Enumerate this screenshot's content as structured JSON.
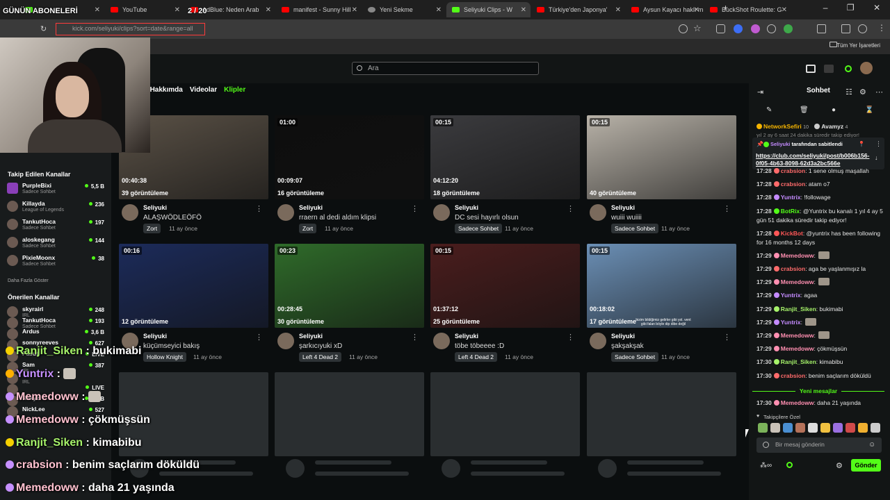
{
  "tabs": [
    {
      "label": "",
      "icon": "kick-icon"
    },
    {
      "label": "YouTube",
      "icon": "youtube-icon"
    },
    {
      "label": "AdBlue: Neden Arab",
      "icon": "youtube-icon"
    },
    {
      "label": "manifest - Sunny Hill",
      "icon": "youtube-icon"
    },
    {
      "label": "Yeni Sekme",
      "icon": "chrome-icon"
    },
    {
      "label": "Seliyuki Clips - W",
      "icon": "kick-icon",
      "active": true
    },
    {
      "label": "Türkiye'den Japonya'",
      "icon": "youtube-icon"
    },
    {
      "label": "Aysun Kayacı haklı m",
      "icon": "youtube-icon"
    },
    {
      "label": "BuckShot Roulette: G",
      "icon": "youtube-icon"
    }
  ],
  "address": {
    "url": "kick.com/seliyuki/clips?sort=date&range=all"
  },
  "bookmarks": {
    "all_label": "Tüm Yer İşaretleri"
  },
  "overlay": {
    "subs_label": "GÜNÜN ABONELERİ",
    "subs_count": "2 / 20"
  },
  "search": {
    "placeholder": "Ara"
  },
  "nav": {
    "partial": "a",
    "about": "Hakkımda",
    "videos": "Videolar",
    "clips": "Klipler"
  },
  "sidebar": {
    "followed_header": "Takip Edilen Kanallar",
    "followed": [
      {
        "name": "PurpleBixi",
        "sub": "Sadece Sohbet",
        "count": "5,5 B"
      },
      {
        "name": "Killayda",
        "sub": "League of Legends",
        "count": "236"
      },
      {
        "name": "TankutHoca",
        "sub": "Sadece Sohbet",
        "count": "197"
      },
      {
        "name": "aloskegang",
        "sub": "Sadece Sohbet",
        "count": "144"
      },
      {
        "name": "PixieMoonx",
        "sub": "Sadece Sohbet",
        "count": "38"
      }
    ],
    "show_more": "Daha Fazla Göster",
    "recommended_header": "Önerilen Kanallar",
    "recommended": [
      {
        "name": "skyrairl",
        "sub": "IRL",
        "count": "248"
      },
      {
        "name": "TankutHoca",
        "sub": "Sadece Sohbet",
        "count": "193"
      },
      {
        "name": "Ardus",
        "sub": "",
        "count": "3,6 B"
      },
      {
        "name": "sonnyreeves",
        "sub": "",
        "count": "627"
      },
      {
        "name": "Pasut",
        "sub": "",
        "count": "LIVE"
      },
      {
        "name": "Sam",
        "sub": "IRL",
        "count": "387"
      },
      {
        "name": "",
        "sub": "IRL",
        "count": ""
      },
      {
        "name": "",
        "sub": "",
        "count": "LIVE"
      },
      {
        "name": "Rakyz",
        "sub": "",
        "count": "3,3 B"
      },
      {
        "name": "NickLee",
        "sub": "",
        "count": "527"
      }
    ]
  },
  "clips": [
    {
      "duration": "",
      "timecode": "00:40:38",
      "views": "39 görüntüleme",
      "user": "Seliyuki",
      "title": "ALAŞWÖDLEÖFÖ",
      "tag": "Zort",
      "age": "11 ay önce",
      "bg": "#5a5146"
    },
    {
      "duration": "01:00",
      "timecode": "00:09:07",
      "views": "16 görüntüleme",
      "user": "Seliyuki",
      "title": "rraern al dedi aldım klipsi",
      "tag": "Zort",
      "age": "11 ay önce",
      "bg": "#0e0e0e"
    },
    {
      "duration": "00:15",
      "timecode": "04:12:20",
      "views": "18 görüntüleme",
      "user": "Seliyuki",
      "title": "DC sesi hayırlı olsun",
      "tag": "Sadece Sohbet",
      "age": "11 ay önce",
      "bg": "#3b3b3e"
    },
    {
      "duration": "00:15",
      "timecode": "",
      "views": "40 görüntüleme",
      "user": "Seliyuki",
      "title": "wuiii wuiiii",
      "tag": "Sadece Sohbet",
      "age": "11 ay önce",
      "bg": "#b8b2a8"
    },
    {
      "duration": "00:16",
      "timecode": "",
      "views": "12 görüntüleme",
      "user": "Seliyuki",
      "title": "küçümseyici bakış",
      "tag": "Hollow Knight",
      "age": "11 ay önce",
      "bg": "#1c2b5a"
    },
    {
      "duration": "00:23",
      "timecode": "00:28:45",
      "views": "30 görüntüleme",
      "user": "Seliyuki",
      "title": "şarkıcıyuki xD",
      "tag": "Left 4 Dead 2",
      "age": "11 ay önce",
      "bg": "#2f6b2a"
    },
    {
      "duration": "00:15",
      "timecode": "01:37:12",
      "views": "25 görüntüleme",
      "user": "Seliyuki",
      "title": "töbe töbeeee :D",
      "tag": "Left 4 Dead 2",
      "age": "11 ay önce",
      "bg": "#4a1d1d"
    },
    {
      "duration": "00:15",
      "timecode": "00:18:02",
      "views": "17 görüntüleme",
      "user": "Seliyuki",
      "title": "şakşakşak",
      "tag": "Sadece Sohbet",
      "age": "11 ay önce",
      "bg": "#6b8fb5",
      "caption": "bizim bildiğimiz gelirler gibi yol. vent gibi falan böyle dip dibe değil"
    }
  ],
  "chat": {
    "title": "Sohbet",
    "top": {
      "user1": "NetworkSefiri",
      "count1": "10",
      "user2": "Avamyz",
      "count2": "4"
    },
    "top_partial": "yıl 2 ay 6 saat 24 dakika süredir takip ediyor!",
    "pinned": {
      "by_user": "Seliyuki",
      "by_text": "tarafından sabitlendi",
      "link": "https://club.com/seliyuki/post/b006b156-0f05-4b63-8098-62d3a2bc566e"
    },
    "messages": [
      {
        "time": "17:28",
        "user": "crabsion",
        "text": ": 1 sene olmuş maşallah",
        "color": "#ff6b6b"
      },
      {
        "time": "17:28",
        "user": "crabsion",
        "text": ": atam o7",
        "color": "#ff6b6b"
      },
      {
        "time": "17:28",
        "user": "Yuntrix",
        "text": ": !followage",
        "color": "#c48bff"
      },
      {
        "time": "17:28",
        "user": "BotRix",
        "text": ": @Yuntrix bu kanalı 1 yıl 4 ay 5 gün 51 dakika süredir takip ediyor!",
        "color": "#53fc18"
      },
      {
        "time": "17:28",
        "user": "KickBot",
        "text": ": @yuntrix has been following for 16 months 12 days",
        "color": "#ff5757"
      },
      {
        "time": "17:29",
        "user": "Memedoww",
        "text": ":",
        "color": "#ff8fb1"
      },
      {
        "time": "17:29",
        "user": "crabsion",
        "text": ": aga be yaşlanmışız la",
        "color": "#ff6b6b"
      },
      {
        "time": "17:29",
        "user": "Memedoww",
        "text": ":",
        "color": "#ff8fb1"
      },
      {
        "time": "17:29",
        "user": "Yuntrix",
        "text": ": agaa",
        "color": "#c48bff"
      },
      {
        "time": "17:29",
        "user": "Ranjit_Siken",
        "text": ": bukimabi",
        "color": "#a6f26a"
      },
      {
        "time": "17:29",
        "user": "Yuntrix",
        "text": ":",
        "color": "#c48bff"
      },
      {
        "time": "17:29",
        "user": "Memedoww",
        "text": ":",
        "color": "#ff8fb1"
      },
      {
        "time": "17:29",
        "user": "Memedoww",
        "text": ": çökmüşsün",
        "color": "#ff8fb1"
      },
      {
        "time": "17:30",
        "user": "Ranjit_Siken",
        "text": ": kimabibu",
        "color": "#a6f26a"
      },
      {
        "time": "17:30",
        "user": "crabsion",
        "text": ": benim saçlarım döküldü",
        "color": "#ff6b6b"
      }
    ],
    "new_messages_label": "Yeni mesajlar",
    "after_new": {
      "time": "17:30",
      "user": "Memedoww",
      "text": ": daha 21 yaşında",
      "color": "#ff8fb1"
    },
    "followers_only": "Takipçilere Özel",
    "input_placeholder": "Bir mesaj gönderin",
    "send_label": "Gönder"
  },
  "overlay_chat": [
    {
      "user": "Ranjit_Siken",
      "text": " : bukimabi",
      "cls": "g"
    },
    {
      "user": "Yuntrix",
      "text": " :",
      "cls": "p",
      "emote": true
    },
    {
      "user": "Memedoww",
      "text": " :",
      "cls": "n",
      "emote": true
    },
    {
      "user": "Memedoww",
      "text": " : çökmüşsün",
      "cls": "n"
    },
    {
      "user": "Ranjit_Siken",
      "text": " : kimabibu",
      "cls": "g"
    },
    {
      "user": "crabsion",
      "text": " : benim saçlarım döküldü",
      "cls": "n"
    },
    {
      "user": "Memedoww",
      "text": " : daha 21 yaşında",
      "cls": "n"
    }
  ]
}
